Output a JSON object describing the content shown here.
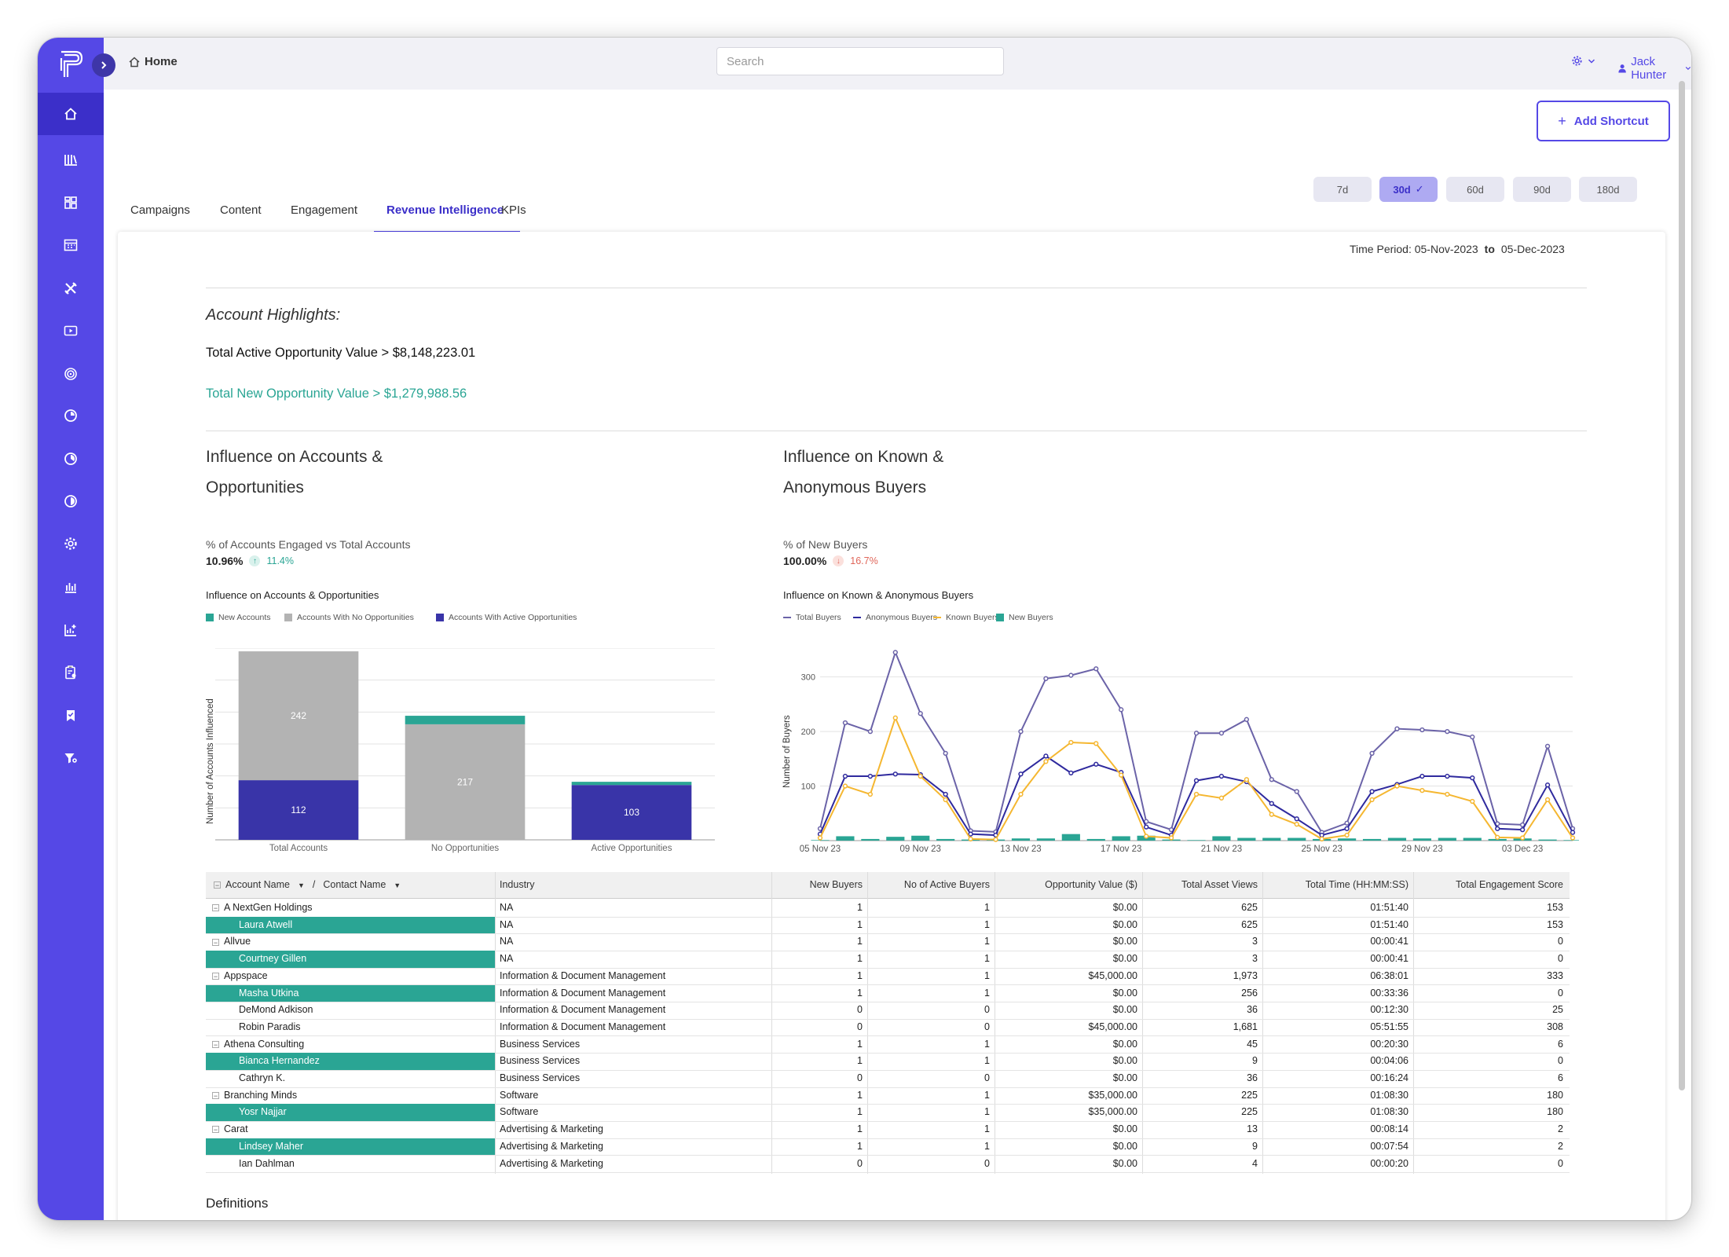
{
  "topbar": {
    "home_label": "Home",
    "search_placeholder": "Search",
    "user_name": "Jack Hunter"
  },
  "shortcut": {
    "label": "Add Shortcut"
  },
  "ranges": [
    {
      "label": "7d",
      "active": false
    },
    {
      "label": "30d",
      "active": true
    },
    {
      "label": "60d",
      "active": false
    },
    {
      "label": "90d",
      "active": false
    },
    {
      "label": "180d",
      "active": false
    }
  ],
  "tabs": [
    {
      "label": "Campaigns",
      "active": false
    },
    {
      "label": "Content",
      "active": false
    },
    {
      "label": "Engagement",
      "active": false
    },
    {
      "label": "Revenue Intelligence",
      "active": true
    },
    {
      "label": "KPIs",
      "active": false
    }
  ],
  "time_period": {
    "prefix": "Time Period: ",
    "from": "05-Nov-2023",
    "to_word": "to",
    "to": "05-Dec-2023"
  },
  "highlights": {
    "heading": "Account Highlights:",
    "active_opportunity": "Total Active Opportunity Value > $8,148,223.01",
    "new_opportunity": "Total New Opportunity Value > $1,279,988.56"
  },
  "left_section": {
    "title_line1": "Influence on Accounts &",
    "title_line2": "Opportunities",
    "metric_label": "% of Accounts Engaged vs Total Accounts",
    "metric_value": "10.96%",
    "metric_change": "11.4%",
    "metric_direction": "up"
  },
  "right_section": {
    "title_line1": "Influence on Known &",
    "title_line2": "Anonymous Buyers",
    "metric_label": "% of New Buyers",
    "metric_value": "100.00%",
    "metric_change": "16.7%",
    "metric_direction": "down"
  },
  "colors": {
    "sidebar": "#5548e6",
    "accent": "#3b2fc9",
    "teal": "#2aa594",
    "gray_bar": "#b3b3b3",
    "navy_bar": "#3934a8",
    "total_buyers": "#6b63a8",
    "anonymous_buyers": "#2f2a9e",
    "known_buyers": "#f5b731",
    "new_buyers": "#2aa594",
    "positive": "#2aa594",
    "negative": "#e0665a"
  },
  "chart_data": [
    {
      "type": "bar",
      "stacked": true,
      "title": "Influence on Accounts & Opportunities",
      "ylabel": "Number of Accounts Influenced",
      "xlabel": "",
      "categories": [
        "Total Accounts",
        "No Opportunities",
        "Active Opportunities"
      ],
      "ylim": [
        0,
        360
      ],
      "legend_position": "top-left",
      "grid": true,
      "series": [
        {
          "name": "Accounts With Active Opportunities",
          "color": "#3934a8",
          "values": [
            112,
            0,
            103
          ],
          "labels": [
            "112",
            "",
            "103"
          ]
        },
        {
          "name": "Accounts With No Opportunities",
          "color": "#b3b3b3",
          "values": [
            242,
            217,
            0
          ],
          "labels": [
            "242",
            "217",
            ""
          ]
        },
        {
          "name": "New Accounts",
          "color": "#2aa594",
          "values": [
            0,
            16,
            6
          ],
          "labels": [
            "",
            "",
            ""
          ]
        }
      ],
      "legend_order": [
        "New Accounts",
        "Accounts With No Opportunities",
        "Accounts With Active Opportunities"
      ]
    },
    {
      "type": "line",
      "title": "Influence on Known & Anonymous Buyers",
      "ylabel": "Number of Buyers",
      "xlabel": "",
      "x_ticks": [
        "05 Nov 23",
        "09 Nov 23",
        "13 Nov 23",
        "17 Nov 23",
        "21 Nov 23",
        "25 Nov 23",
        "29 Nov 23",
        "03 Dec 23"
      ],
      "y_ticks": [
        100,
        200,
        300
      ],
      "ylim": [
        0,
        360
      ],
      "legend_position": "top-left",
      "grid": true,
      "x": [
        "05 Nov",
        "06 Nov",
        "07 Nov",
        "08 Nov",
        "09 Nov",
        "10 Nov",
        "11 Nov",
        "12 Nov",
        "13 Nov",
        "14 Nov",
        "15 Nov",
        "16 Nov",
        "17 Nov",
        "18 Nov",
        "19 Nov",
        "20 Nov",
        "21 Nov",
        "22 Nov",
        "23 Nov",
        "24 Nov",
        "25 Nov",
        "26 Nov",
        "27 Nov",
        "28 Nov",
        "29 Nov",
        "30 Nov",
        "01 Dec",
        "02 Dec",
        "03 Dec",
        "04 Dec",
        "05 Dec"
      ],
      "series": [
        {
          "name": "Total Buyers",
          "kind": "line",
          "color": "#6b63a8",
          "values": [
            22,
            216,
            200,
            345,
            233,
            160,
            18,
            16,
            200,
            297,
            303,
            315,
            240,
            35,
            20,
            197,
            197,
            222,
            112,
            90,
            15,
            32,
            160,
            205,
            203,
            200,
            190,
            31,
            29,
            173,
            22
          ]
        },
        {
          "name": "Anonymous Buyers",
          "kind": "line",
          "color": "#2f2a9e",
          "values": [
            12,
            118,
            118,
            122,
            121,
            85,
            12,
            10,
            122,
            155,
            124,
            140,
            125,
            25,
            10,
            110,
            118,
            108,
            68,
            40,
            10,
            22,
            90,
            103,
            118,
            118,
            115,
            22,
            20,
            102,
            15
          ]
        },
        {
          "name": "Known Buyers",
          "kind": "line",
          "color": "#f5b731",
          "values": [
            5,
            100,
            85,
            225,
            118,
            75,
            3,
            2,
            85,
            145,
            180,
            178,
            120,
            8,
            5,
            85,
            78,
            112,
            48,
            30,
            3,
            10,
            75,
            100,
            92,
            85,
            72,
            6,
            5,
            75,
            5
          ]
        },
        {
          "name": "New Buyers",
          "kind": "bar",
          "color": "#2aa594",
          "values": [
            1,
            8,
            3,
            7,
            9,
            3,
            2,
            2,
            4,
            4,
            12,
            3,
            8,
            9,
            2,
            1,
            8,
            5,
            5,
            5,
            3,
            4,
            3,
            5,
            4,
            5,
            5,
            3,
            4,
            2,
            1
          ]
        }
      ]
    }
  ],
  "table": {
    "columns": [
      "Account Name",
      "Contact Name",
      "Industry",
      "New Buyers",
      "No of Active Buyers",
      "Opportunity Value ($)",
      "Total Asset Views",
      "Total Time (HH:MM:SS)",
      "Total Engagement Score"
    ],
    "rows": [
      {
        "type": "account",
        "name": "A NextGen Holdings",
        "industry": "NA",
        "new_buyers": "1",
        "active_buyers": "1",
        "opportunity": "$0.00",
        "asset_views": "625",
        "time": "01:51:40",
        "score": "153"
      },
      {
        "type": "contact",
        "highlight": true,
        "name": "Laura Atwell",
        "industry": "NA",
        "new_buyers": "1",
        "active_buyers": "1",
        "opportunity": "$0.00",
        "asset_views": "625",
        "time": "01:51:40",
        "score": "153"
      },
      {
        "type": "account",
        "name": "Allvue",
        "industry": "NA",
        "new_buyers": "1",
        "active_buyers": "1",
        "opportunity": "$0.00",
        "asset_views": "3",
        "time": "00:00:41",
        "score": "0"
      },
      {
        "type": "contact",
        "highlight": true,
        "name": "Courtney Gillen",
        "industry": "NA",
        "new_buyers": "1",
        "active_buyers": "1",
        "opportunity": "$0.00",
        "asset_views": "3",
        "time": "00:00:41",
        "score": "0"
      },
      {
        "type": "account",
        "name": "Appspace",
        "industry": "Information & Document Management",
        "new_buyers": "1",
        "active_buyers": "1",
        "opportunity": "$45,000.00",
        "asset_views": "1,973",
        "time": "06:38:01",
        "score": "333"
      },
      {
        "type": "contact",
        "highlight": true,
        "name": "Masha Utkina",
        "industry": "Information & Document Management",
        "new_buyers": "1",
        "active_buyers": "1",
        "opportunity": "$0.00",
        "asset_views": "256",
        "time": "00:33:36",
        "score": "0"
      },
      {
        "type": "contact",
        "highlight": false,
        "name": "DeMond Adkison",
        "industry": "Information & Document Management",
        "new_buyers": "0",
        "active_buyers": "0",
        "opportunity": "$0.00",
        "asset_views": "36",
        "time": "00:12:30",
        "score": "25"
      },
      {
        "type": "contact",
        "highlight": false,
        "name": "Robin Paradis",
        "industry": "Information & Document Management",
        "new_buyers": "0",
        "active_buyers": "0",
        "opportunity": "$45,000.00",
        "asset_views": "1,681",
        "time": "05:51:55",
        "score": "308"
      },
      {
        "type": "account",
        "name": "Athena Consulting",
        "industry": "Business Services",
        "new_buyers": "1",
        "active_buyers": "1",
        "opportunity": "$0.00",
        "asset_views": "45",
        "time": "00:20:30",
        "score": "6"
      },
      {
        "type": "contact",
        "highlight": true,
        "name": "Bianca Hernandez",
        "industry": "Business Services",
        "new_buyers": "1",
        "active_buyers": "1",
        "opportunity": "$0.00",
        "asset_views": "9",
        "time": "00:04:06",
        "score": "0"
      },
      {
        "type": "contact",
        "highlight": false,
        "name": "Cathryn K.",
        "industry": "Business Services",
        "new_buyers": "0",
        "active_buyers": "0",
        "opportunity": "$0.00",
        "asset_views": "36",
        "time": "00:16:24",
        "score": "6"
      },
      {
        "type": "account",
        "name": "Branching Minds",
        "industry": "Software",
        "new_buyers": "1",
        "active_buyers": "1",
        "opportunity": "$35,000.00",
        "asset_views": "225",
        "time": "01:08:30",
        "score": "180"
      },
      {
        "type": "contact",
        "highlight": true,
        "name": "Yosr Najjar",
        "industry": "Software",
        "new_buyers": "1",
        "active_buyers": "1",
        "opportunity": "$35,000.00",
        "asset_views": "225",
        "time": "01:08:30",
        "score": "180"
      },
      {
        "type": "account",
        "name": "Carat",
        "industry": "Advertising & Marketing",
        "new_buyers": "1",
        "active_buyers": "1",
        "opportunity": "$0.00",
        "asset_views": "13",
        "time": "00:08:14",
        "score": "2"
      },
      {
        "type": "contact",
        "highlight": true,
        "name": "Lindsey Maher",
        "industry": "Advertising & Marketing",
        "new_buyers": "1",
        "active_buyers": "1",
        "opportunity": "$0.00",
        "asset_views": "9",
        "time": "00:07:54",
        "score": "2"
      },
      {
        "type": "contact",
        "highlight": false,
        "name": "Ian Dahlman",
        "industry": "Advertising & Marketing",
        "new_buyers": "0",
        "active_buyers": "0",
        "opportunity": "$0.00",
        "asset_views": "4",
        "time": "00:00:20",
        "score": "0"
      }
    ]
  },
  "definitions": {
    "heading": "Definitions"
  },
  "sidebar": {
    "items": [
      {
        "icon": "home-icon",
        "active": true
      },
      {
        "icon": "library-icon",
        "active": false
      },
      {
        "icon": "dashboard-grid-icon",
        "active": false
      },
      {
        "icon": "calendar-board-icon",
        "active": false
      },
      {
        "icon": "tools-icon",
        "active": false
      },
      {
        "icon": "video-icon",
        "active": false
      },
      {
        "icon": "target-icon",
        "active": false
      },
      {
        "icon": "pie-chart-icon",
        "active": false
      },
      {
        "icon": "pie-chart-alt-icon",
        "active": false
      },
      {
        "icon": "pie-chart-third-icon",
        "active": false
      },
      {
        "icon": "gear-icon",
        "active": false
      },
      {
        "icon": "bar-chart-icon",
        "active": false
      },
      {
        "icon": "report-add-icon",
        "active": false
      },
      {
        "icon": "clipboard-settings-icon",
        "active": false
      },
      {
        "icon": "bookmark-check-icon",
        "active": false
      },
      {
        "icon": "filter-settings-icon",
        "active": false
      }
    ]
  }
}
